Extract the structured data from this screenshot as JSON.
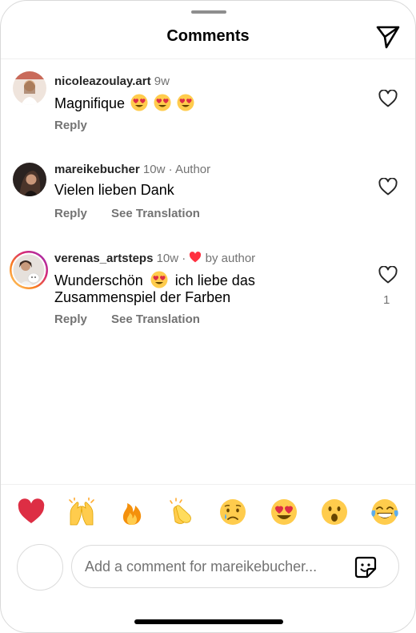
{
  "header": {
    "title": "Comments"
  },
  "comments": [
    {
      "username": "nicoleazoulay.art",
      "time": "9w",
      "text": "Magnifique",
      "emojis": [
        "heart-eyes",
        "heart-eyes",
        "heart-eyes"
      ],
      "reply_label": "Reply"
    },
    {
      "username": "mareikebucher",
      "time": "10w",
      "separator": "·",
      "tag": "Author",
      "text": "Vielen lieben Dank",
      "reply_label": "Reply",
      "translate_label": "See Translation"
    },
    {
      "username": "verenas_artsteps",
      "time": "10w",
      "separator": "·",
      "liked_tag": "by author",
      "text_line1": "Wunderschön",
      "text_line1_after": "ich liebe das",
      "text_line2": "Zusammenspiel der Farben",
      "reply_label": "Reply",
      "translate_label": "See Translation",
      "like_count": "1"
    }
  ],
  "reactions": [
    "red-heart",
    "raising-hands",
    "fire",
    "clapping-hands",
    "crying-face",
    "heart-eyes",
    "surprised-face",
    "tears-of-joy"
  ],
  "composer": {
    "placeholder": "Add a comment for mareikebucher..."
  },
  "colors": {
    "muted": "#737373",
    "like_red": "#ff3040",
    "divider": "#efefef"
  }
}
